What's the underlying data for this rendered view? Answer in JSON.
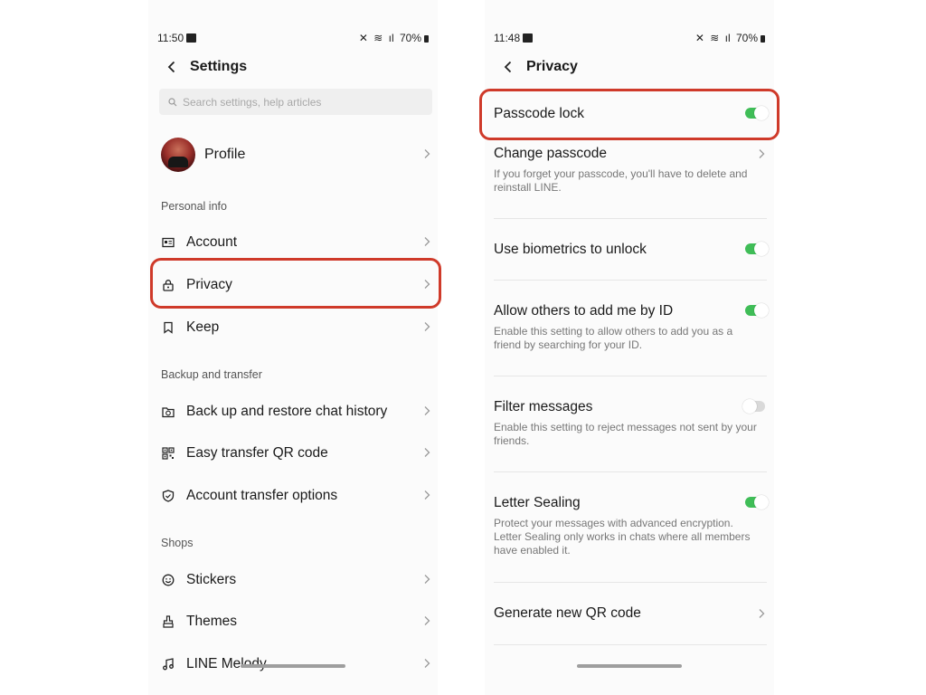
{
  "left": {
    "status": {
      "time": "11:50",
      "battery": "70%"
    },
    "header": {
      "title": "Settings"
    },
    "search": {
      "placeholder": "Search settings, help articles"
    },
    "profile": {
      "label": "Profile"
    },
    "sections": {
      "personal_info": "Personal info",
      "backup": "Backup and transfer",
      "shops": "Shops"
    },
    "items": {
      "account": "Account",
      "privacy": "Privacy",
      "keep": "Keep",
      "backup_restore": "Back up and restore chat history",
      "easy_transfer": "Easy transfer QR code",
      "account_transfer": "Account transfer options",
      "stickers": "Stickers",
      "themes": "Themes",
      "line_melody": "LINE Melody"
    }
  },
  "right": {
    "status": {
      "time": "11:48",
      "battery": "70%"
    },
    "header": {
      "title": "Privacy"
    },
    "rows": {
      "passcode_lock": {
        "title": "Passcode lock",
        "on": true
      },
      "change_passcode": {
        "title": "Change passcode",
        "desc": "If you forget your passcode, you'll have to delete and reinstall LINE."
      },
      "biometrics": {
        "title": "Use biometrics to unlock",
        "on": true
      },
      "allow_add_id": {
        "title": "Allow others to add me by ID",
        "desc": "Enable this setting to allow others to add you as a friend by searching for your ID.",
        "on": true
      },
      "filter_messages": {
        "title": "Filter messages",
        "desc": "Enable this setting to reject messages not sent by your friends.",
        "on": false
      },
      "letter_sealing": {
        "title": "Letter Sealing",
        "desc": "Protect your messages with advanced encryption. Letter Sealing only works in chats where all members have enabled it.",
        "on": true
      },
      "generate_qr": {
        "title": "Generate new QR code"
      }
    }
  },
  "colors": {
    "highlight": "#cf3a2a",
    "toggle_on": "#3fbd57",
    "toggle_off": "#d9d9d9"
  },
  "icons": [
    "back-arrow-icon",
    "search-icon",
    "chevron-right-icon",
    "account-card-icon",
    "lock-icon",
    "bookmark-icon",
    "backup-icon",
    "qr-code-icon",
    "shield-icon",
    "smiley-icon",
    "brush-icon",
    "music-note-icon"
  ]
}
